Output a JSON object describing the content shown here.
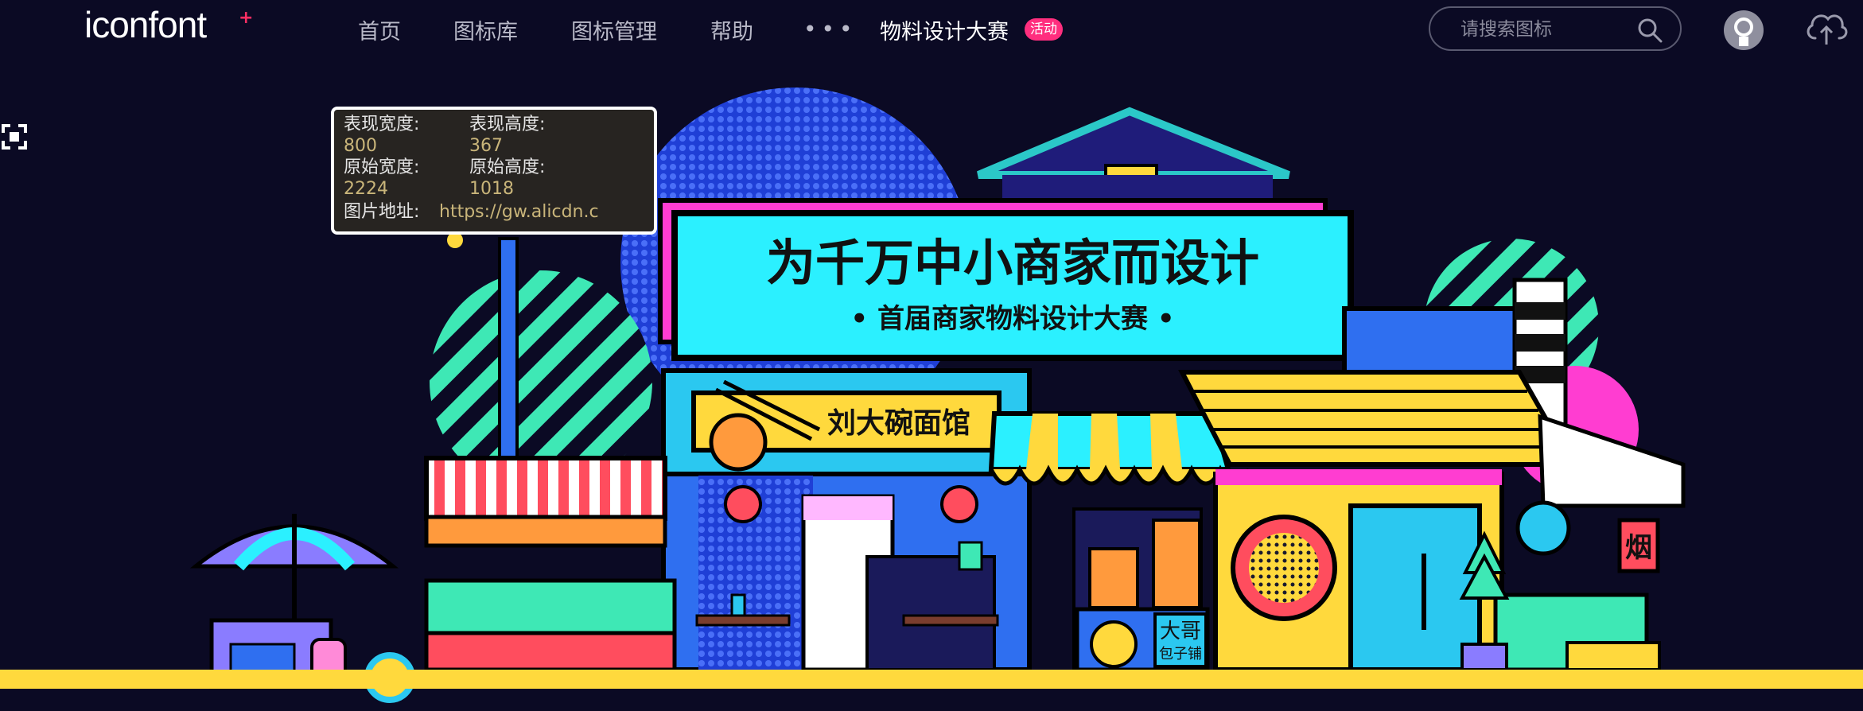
{
  "header": {
    "logo": "iconfont",
    "logo_plus": "+",
    "nav": {
      "home": "首页",
      "library": "图标库",
      "manage": "图标管理",
      "help": "帮助",
      "more": "•••",
      "contest": "物料设计大赛",
      "contest_badge": "活动"
    },
    "search_placeholder": "请搜索图标"
  },
  "hero": {
    "title": "为千万中小商家而设计",
    "subtitle": "• 首届商家物料设计大赛 •",
    "noodle_sign": "刘大碗面馆",
    "bun_sign_line1": "大哥",
    "bun_sign_line2": "包子铺",
    "smoke_sign": "烟"
  },
  "image_info": {
    "display_width_label": "表现宽度:",
    "display_width_value": "800",
    "display_height_label": "表现高度:",
    "display_height_value": "367",
    "original_width_label": "原始宽度:",
    "original_width_value": "2224",
    "original_height_label": "原始高度:",
    "original_height_value": "1018",
    "url_label": "图片地址:",
    "url_value": "https://gw.alicdn.c"
  },
  "colors": {
    "background": "#0b0a24",
    "cyan": "#2bf0ff",
    "yellow": "#ffd93d",
    "pink": "#ff2e7e",
    "magenta": "#ff3dd1",
    "blue": "#2f6ff0",
    "green": "#3ee8b5",
    "red": "#ff4d5e",
    "orange": "#ff8a3d",
    "purple": "#8a7cff"
  },
  "icons": [
    "search-icon",
    "user-avatar-icon",
    "upload-cloud-icon",
    "fullscreen-icon"
  ]
}
